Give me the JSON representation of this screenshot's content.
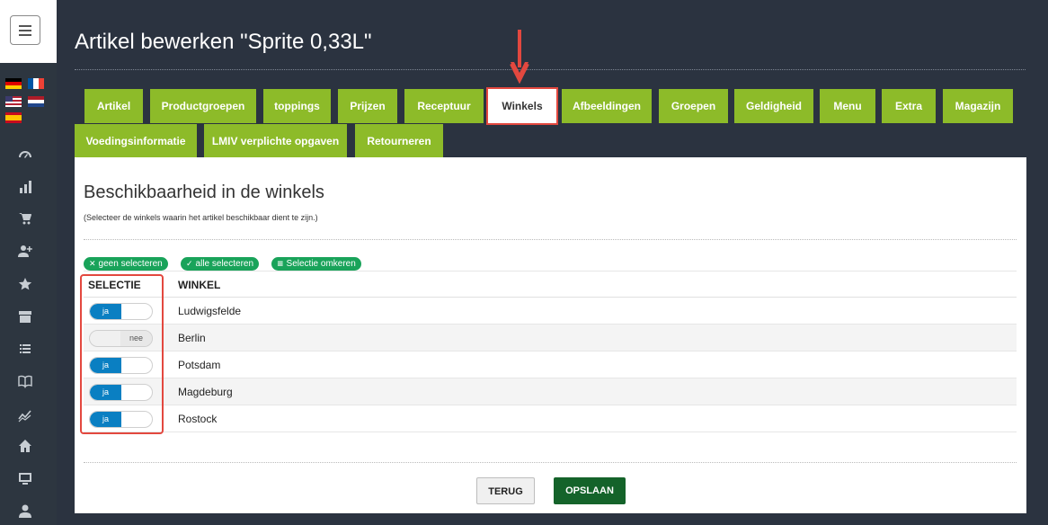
{
  "page": {
    "title": "Artikel bewerken \"Sprite 0,33L\""
  },
  "sidebar": {
    "menu_icon": "hamburger-menu-icon",
    "flags": [
      "german-flag",
      "french-flag",
      "us-flag",
      "dutch-flag",
      "spanish-flag"
    ],
    "icons": [
      "dashboard-gauge-icon",
      "bar-chart-icon",
      "cart-icon",
      "add-user-icon",
      "star-icon",
      "archive-icon",
      "list-icon",
      "book-icon",
      "trend-line-icon",
      "home-icon",
      "monitor-icon",
      "user-icon"
    ]
  },
  "tabs": [
    {
      "label": "Artikel"
    },
    {
      "label": "Productgroepen"
    },
    {
      "label": "toppings"
    },
    {
      "label": "Prijzen"
    },
    {
      "label": "Receptuur"
    },
    {
      "label": "Winkels",
      "active": true
    },
    {
      "label": "Afbeeldingen"
    },
    {
      "label": "Groepen"
    },
    {
      "label": "Geldigheid"
    },
    {
      "label": "Menu"
    },
    {
      "label": "Extra"
    },
    {
      "label": "Magazijn"
    },
    {
      "label": "Voedingsinformatie"
    },
    {
      "label": "LMIV verplichte opgaven"
    },
    {
      "label": "Retourneren"
    }
  ],
  "section": {
    "title": "Beschikbaarheid in de winkels",
    "subtitle": "(Selecteer de winkels waarin het artikel beschikbaar dient te zijn.)"
  },
  "actions": {
    "none": "geen selecteren",
    "all": "alle selecteren",
    "invert": "Selectie omkeren"
  },
  "table": {
    "headers": {
      "selection": "SELECTIE",
      "store": "WINKEL"
    },
    "rows": [
      {
        "toggle": "ja",
        "store": "Ludwigsfelde"
      },
      {
        "toggle": "nee",
        "store": "Berlin"
      },
      {
        "toggle": "ja",
        "store": "Potsdam"
      },
      {
        "toggle": "ja",
        "store": "Magdeburg"
      },
      {
        "toggle": "ja",
        "store": "Rostock"
      }
    ]
  },
  "buttons": {
    "back": "TERUG",
    "save": "OPSLAAN"
  },
  "colors": {
    "tab_green": "#8dbb29",
    "highlight_red": "#e3483f",
    "toggle_blue": "#0a7fc2",
    "save_green": "#14632a",
    "pill_green": "#19a35a"
  }
}
